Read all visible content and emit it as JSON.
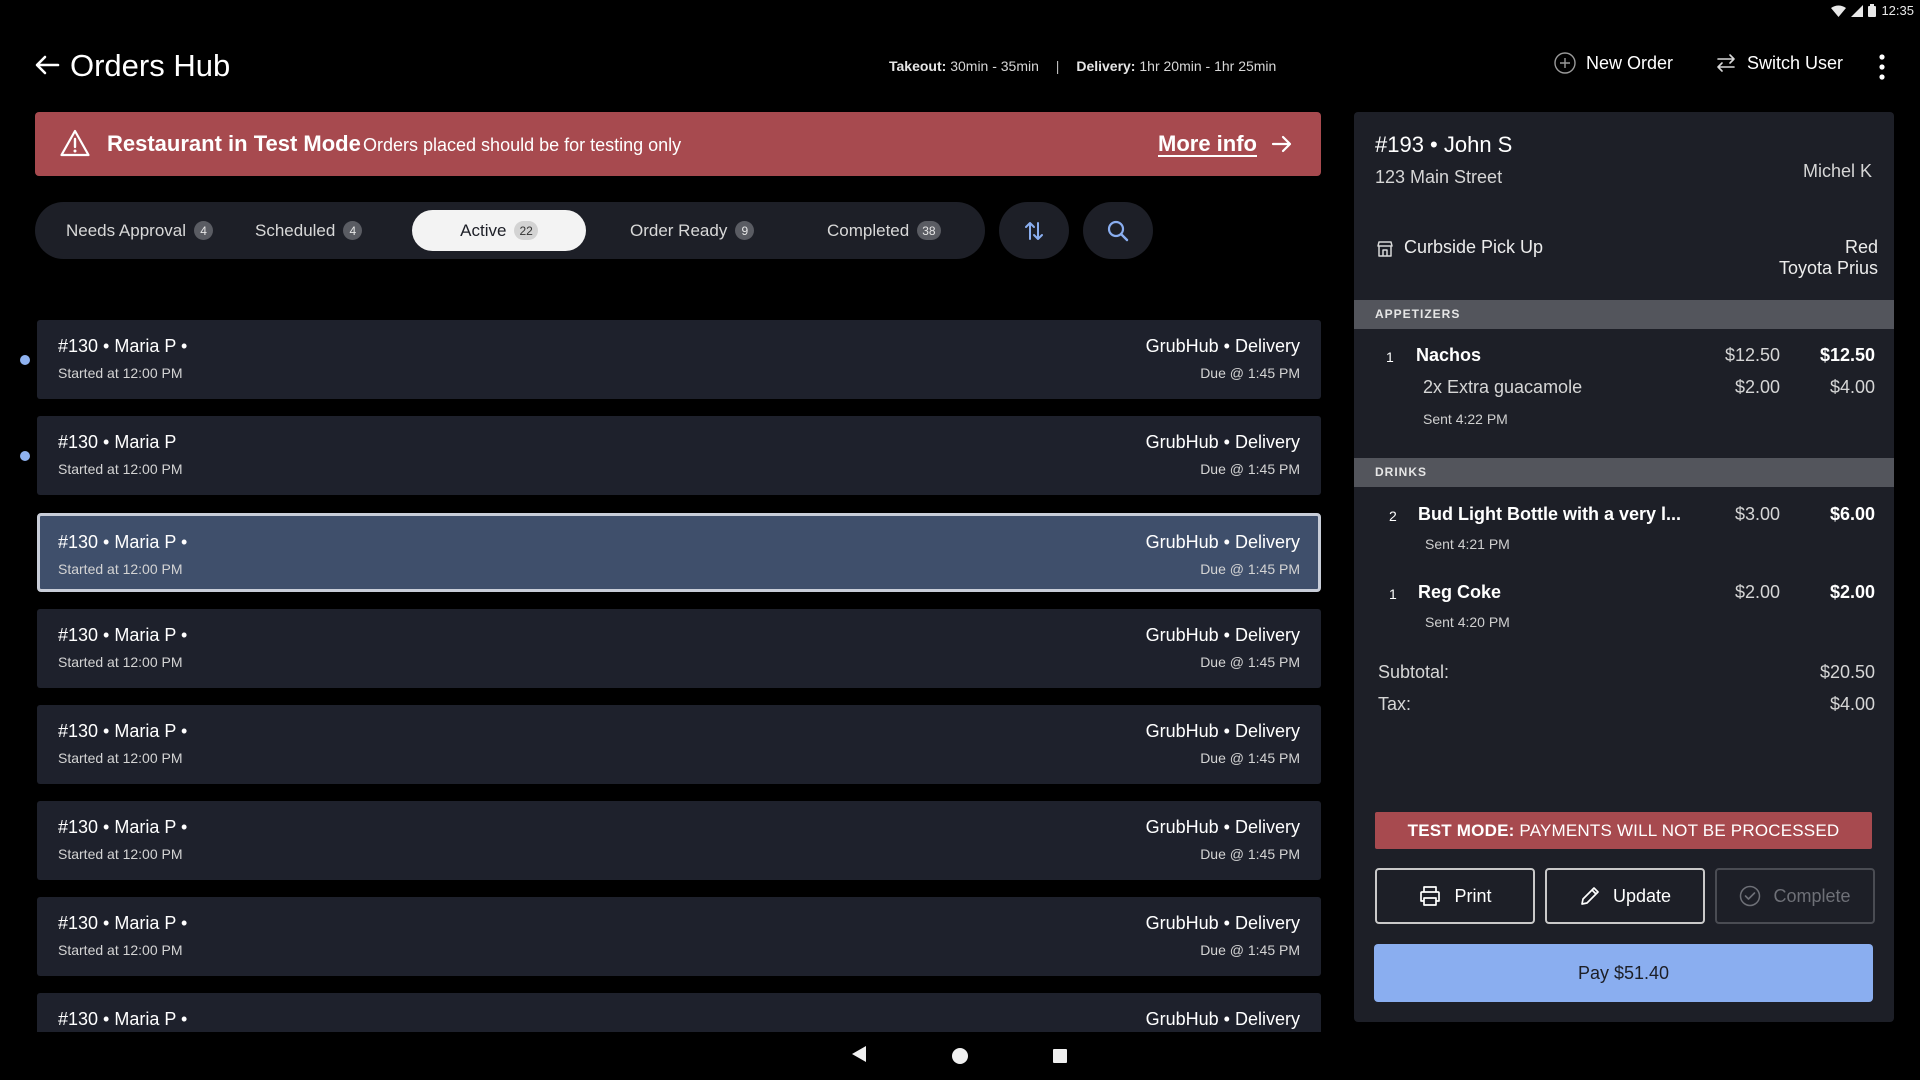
{
  "status_bar": {
    "time": "12:35"
  },
  "header": {
    "title": "Orders Hub",
    "takeout_label": "Takeout:",
    "takeout_value": "30min - 35min",
    "separator": "|",
    "delivery_label": "Delivery:",
    "delivery_value": "1hr 20min - 1hr 25min",
    "new_order": "New Order",
    "switch_user": "Switch User"
  },
  "banner": {
    "title": "Restaurant in Test Mode",
    "text": "Orders placed should be for testing only",
    "link": "More info"
  },
  "tabs": [
    {
      "label": "Needs Approval",
      "count": "4"
    },
    {
      "label": "Scheduled",
      "count": "4"
    },
    {
      "label": "Active",
      "count": "22"
    },
    {
      "label": "Order Ready",
      "count": "9"
    },
    {
      "label": "Completed",
      "count": "38"
    }
  ],
  "orders": [
    {
      "title": "#130 • Maria P •",
      "started": "Started at 12:00 PM",
      "source": "GrubHub • Delivery",
      "due": "Due @ 1:45 PM"
    },
    {
      "title": "#130 • Maria P",
      "started": "Started at 12:00 PM",
      "source": "GrubHub • Delivery",
      "due": "Due @ 1:45 PM"
    },
    {
      "title": "#130 • Maria P •",
      "started": "Started at 12:00 PM",
      "source": "GrubHub • Delivery",
      "due": "Due @ 1:45 PM"
    },
    {
      "title": "#130 • Maria P •",
      "started": "Started at 12:00 PM",
      "source": "GrubHub • Delivery",
      "due": "Due @ 1:45 PM"
    },
    {
      "title": "#130 • Maria P •",
      "started": "Started at 12:00 PM",
      "source": "GrubHub • Delivery",
      "due": "Due @ 1:45 PM"
    },
    {
      "title": "#130 • Maria P •",
      "started": "Started at 12:00 PM",
      "source": "GrubHub • Delivery",
      "due": "Due @ 1:45 PM"
    },
    {
      "title": "#130 • Maria P •",
      "started": "Started at 12:00 PM",
      "source": "GrubHub • Delivery",
      "due": "Due @ 1:45 PM"
    },
    {
      "title": "#130 • Maria P •",
      "started": "",
      "source": "GrubHub • Delivery",
      "due": ""
    }
  ],
  "detail": {
    "title": "#193 • John S",
    "address": "123 Main Street",
    "server": "Michel K",
    "pickup": "Curbside Pick Up",
    "car_color": "Red",
    "car_model": "Toyota Prius",
    "sections": {
      "appetizers": "APPETIZERS",
      "drinks": "DRINKS"
    },
    "items": {
      "nachos": {
        "qty": "1",
        "name": "Nachos",
        "unit": "$12.50",
        "total": "$12.50",
        "mod": "2x Extra guacamole",
        "mod_unit": "$2.00",
        "mod_total": "$4.00",
        "sent": "Sent 4:22 PM"
      },
      "bud": {
        "qty": "2",
        "name": "Bud Light Bottle with a very l...",
        "unit": "$3.00",
        "total": "$6.00",
        "sent": "Sent 4:21 PM"
      },
      "coke": {
        "qty": "1",
        "name": "Reg Coke",
        "unit": "$2.00",
        "total": "$2.00",
        "sent": "Sent 4:20 PM"
      }
    },
    "subtotal_label": "Subtotal:",
    "subtotal": "$20.50",
    "tax_label": "Tax:",
    "tax": "$4.00",
    "test_mode_label": "TEST MODE:",
    "test_mode_text": "PAYMENTS WILL NOT BE PROCESSED",
    "print": "Print",
    "update": "Update",
    "complete": "Complete",
    "pay": "Pay $51.40"
  },
  "colors": {
    "banner": "#a74a4f",
    "selected_card": "#3f4f6b",
    "pay_button": "#8aaef0",
    "unread_dot": "#8fb2f0"
  }
}
